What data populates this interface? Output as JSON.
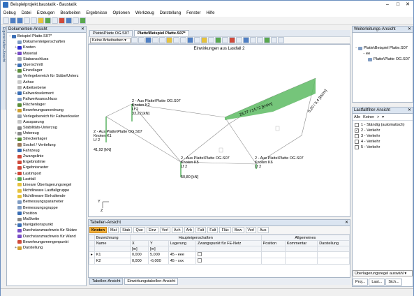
{
  "title": "Beispielprojekt.baustatik - Baustatik",
  "menu": [
    "Debug",
    "Datei",
    "Erzeugen",
    "Bearbeiten",
    "Ergebnisse",
    "Optionen",
    "Werkzeug",
    "Darstellung",
    "Fenster",
    "Hilfe"
  ],
  "sidetab": "Eigenschaften-Ansicht",
  "left_panel": {
    "title": "Dokumenten-Ansicht",
    "items": [
      {
        "label": "Beispiel Platte.S07*",
        "indent": 0,
        "exp": "−",
        "color": "#3b6fb5"
      },
      {
        "label": "Dokumenteigenschaften",
        "indent": 1,
        "exp": "",
        "color": "#7f9cc3"
      },
      {
        "label": "Knoten",
        "indent": 1,
        "exp": "+",
        "color": "#2b2bd0"
      },
      {
        "label": "Material",
        "indent": 1,
        "exp": "+",
        "color": "#7a4ec8"
      },
      {
        "label": "Stabanschluss",
        "indent": 1,
        "exp": "",
        "color": "#9aa2ad"
      },
      {
        "label": "Querschnitt",
        "indent": 1,
        "exp": "+",
        "color": "#3b6fb5"
      },
      {
        "label": "Einzellager",
        "indent": 1,
        "exp": "+",
        "color": "#5a8e3a"
      },
      {
        "label": "Verlegebereich für Stäbe/Unterz",
        "indent": 1,
        "exp": "",
        "color": "#9aa2ad"
      },
      {
        "label": "Achse",
        "indent": 1,
        "exp": "",
        "color": "#c9c9c9"
      },
      {
        "label": "Arbeitsebene",
        "indent": 1,
        "exp": "",
        "color": "#b0b0b0"
      },
      {
        "label": "Faltwerkselement",
        "indent": 1,
        "exp": "+",
        "color": "#3b6fb5"
      },
      {
        "label": "Faltwerksanschluss",
        "indent": 1,
        "exp": "",
        "color": "#7f9cc3"
      },
      {
        "label": "Flächenlager",
        "indent": 1,
        "exp": "",
        "color": "#5a8e3a"
      },
      {
        "label": "Bewehrungsanordnung",
        "indent": 1,
        "exp": "+",
        "color": "#d0a030"
      },
      {
        "label": "Verlegebereich für Faltwerkseler",
        "indent": 1,
        "exp": "",
        "color": "#9aa2ad"
      },
      {
        "label": "Aussparung",
        "indent": 1,
        "exp": "",
        "color": "#c4c4c4"
      },
      {
        "label": "Stabilitäts-Unterzug",
        "indent": 1,
        "exp": "",
        "color": "#8a8a8a"
      },
      {
        "label": "Unterzug",
        "indent": 1,
        "exp": "+",
        "color": "#8a8a8a"
      },
      {
        "label": "Streckenlager",
        "indent": 1,
        "exp": "+",
        "color": "#5a8e3a"
      },
      {
        "label": "Sockel / Vertiefung",
        "indent": 1,
        "exp": "",
        "color": "#9a7a5a"
      },
      {
        "label": "Fahrzeug",
        "indent": 1,
        "exp": "",
        "color": "#3b6fb5"
      },
      {
        "label": "Zwangslinie",
        "indent": 1,
        "exp": "",
        "color": "#d04a3a"
      },
      {
        "label": "Ergebnislinie",
        "indent": 1,
        "exp": "",
        "color": "#d04a3a"
      },
      {
        "label": "Ergebnisraster",
        "indent": 1,
        "exp": "",
        "color": "#d04a3a"
      },
      {
        "label": "Lastimport",
        "indent": 1,
        "exp": "+",
        "color": "#d04a3a"
      },
      {
        "label": "Lastfall",
        "indent": 1,
        "exp": "+",
        "color": "#5aa84e"
      },
      {
        "label": "Lineare Überlagerungsregel",
        "indent": 1,
        "exp": "",
        "color": "#e6c23c"
      },
      {
        "label": "Nichtlineare Lastfallgruppe",
        "indent": 1,
        "exp": "",
        "color": "#e6c23c"
      },
      {
        "label": "Nichtlineare Einhaltende",
        "indent": 1,
        "exp": "",
        "color": "#e6c23c"
      },
      {
        "label": "Bemessungsparameter",
        "indent": 1,
        "exp": "",
        "color": "#7f9cc3"
      },
      {
        "label": "Bemessungsgruppe",
        "indent": 1,
        "exp": "",
        "color": "#7f9cc3"
      },
      {
        "label": "Position",
        "indent": 1,
        "exp": "",
        "color": "#3b6fb5"
      },
      {
        "label": "Maßkette",
        "indent": 1,
        "exp": "",
        "color": "#888"
      },
      {
        "label": "Navigationspunkt",
        "indent": 1,
        "exp": "+",
        "color": "#3b6fb5"
      },
      {
        "label": "Durchstanznachweis für Stütze",
        "indent": 1,
        "exp": "",
        "color": "#7a4ec8"
      },
      {
        "label": "Durchstanznachweis für Wand",
        "indent": 1,
        "exp": "",
        "color": "#7a4ec8"
      },
      {
        "label": "Bewehrungsmengenpunkt",
        "indent": 1,
        "exp": "",
        "color": "#d04a3a"
      },
      {
        "label": "Darstellung",
        "indent": 1,
        "exp": "+",
        "color": "#d0a030"
      }
    ]
  },
  "tabs": [
    "Platte\\Platte OG.S07",
    "Platte\\Beispiel Platte.S07*"
  ],
  "view": {
    "combo": "Keine Arbeitseben ▾",
    "title": "Einwirkungen aus Lastfall 2"
  },
  "labels": {
    "k2_a": "2 - Aus Platte\\Platte OG.S07",
    "k2_b": "Knoten K2",
    "k2_c": "Lf 2",
    "k2_d": "33,22 [kN]",
    "k1_a": "2 - Aus Platte\\Platte OG.S07",
    "k1_b": "Knoten K1",
    "k1_c": "Lf 2",
    "k1_d": "41,92 [kN]",
    "k5_a": "2 - Aus Platte\\Platte OG.S07",
    "k5_b": "Knoten K5",
    "k5_c": "Lf 2",
    "k5_d": "50,80 [kN]",
    "k6_a": "2 - Aus Platte\\Platte OG.S07",
    "k6_b": "Knoten K6",
    "k6_c": "Lf 2",
    "line_load_1": "28,77 / 14,72 [kN/m]",
    "line_load_2": "6,20 / 5,4 [kN/m]",
    "axis_y": "Y",
    "axis_z": "Z"
  },
  "right_top": {
    "title": "Weiterleitungs-Ansicht",
    "items": [
      "Platte\\Beispiel Platte.S07",
      "ee",
      "Platte\\Platte OG.S07"
    ]
  },
  "right_mid": {
    "title": "Lastfallfilter-Ansicht",
    "toolbar": [
      "Alle",
      "Keiner",
      ">",
      "▾"
    ],
    "items": [
      {
        "label": "1 - Ständig (automatisch)",
        "checked": false
      },
      {
        "label": "2 - Verkehr",
        "checked": true
      },
      {
        "label": "3 - Verkehr",
        "checked": false
      },
      {
        "label": "4 - Verkehr",
        "checked": false
      },
      {
        "label": "5 - Verkehr",
        "checked": false
      }
    ],
    "dropdown": "Überlagerungsregel auswähl ▾",
    "bottom_tabs": [
      "Proj...",
      "Last...",
      "Sich..."
    ]
  },
  "table": {
    "title": "Tabellen-Ansicht",
    "toolbar": [
      "Knoten",
      "Mat",
      "Stab",
      "Que",
      "Einz",
      "Verl",
      "Ach",
      "Arb",
      "Falt",
      "Falt",
      "Fläc",
      "Bew",
      "Verl",
      "Aus"
    ],
    "group_header": [
      "Bezeichnung",
      "Haupteigenschaften",
      "Allgemeines"
    ],
    "columns": [
      "Name",
      "X",
      "Y",
      "Lagerung",
      "Zwangspunkt für FE-Netz",
      "Position",
      "Kommentar",
      "Darstellung"
    ],
    "units": [
      "",
      "[m]",
      "[m]",
      "",
      "",
      "",
      "",
      ""
    ],
    "rows": [
      [
        "K1",
        "0,000",
        "5,000",
        "45 - eee",
        "",
        "",
        "",
        ""
      ],
      [
        "K2",
        "0,000",
        "-6,000",
        "45 - xxx",
        "",
        "",
        "",
        ""
      ]
    ]
  },
  "bottom_tabs": [
    "Tabellen-Ansicht",
    "Einwirkungstabellen-Ansicht"
  ]
}
